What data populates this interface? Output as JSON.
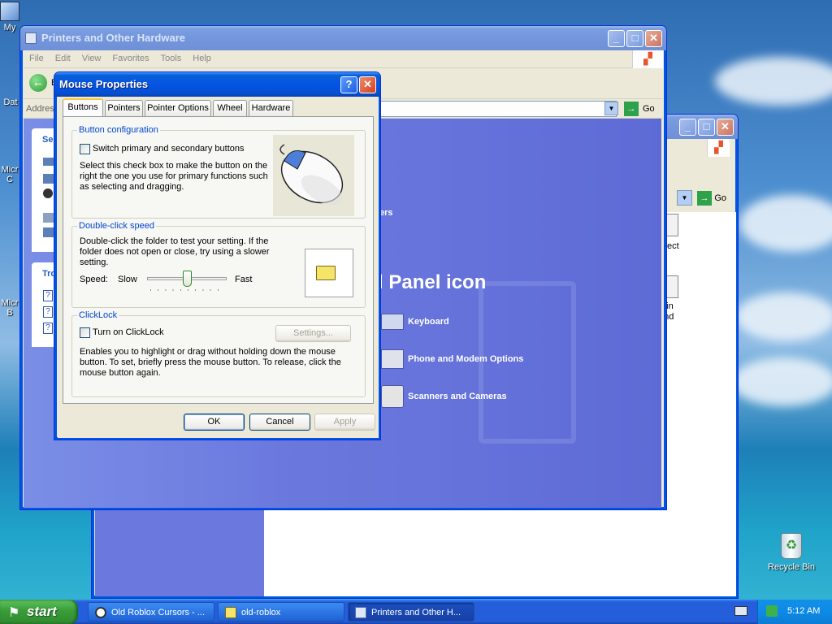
{
  "desktop": {
    "icons": [
      {
        "label": "My"
      },
      {
        "label": "Dat"
      },
      {
        "label": "Micr C"
      },
      {
        "label": "Micr B"
      },
      {
        "label": "Recycle Bin"
      }
    ]
  },
  "back_window": {
    "address_go": "Go",
    "items": [
      {
        "label": "ect"
      },
      {
        "label": "g in"
      },
      {
        "label": "und"
      }
    ]
  },
  "main_window": {
    "title": "Printers and Other Hardware",
    "menu": [
      "File",
      "Edit",
      "View",
      "Favorites",
      "Tools",
      "Help"
    ],
    "back_label": "B",
    "address_label": "Address",
    "go_label": "Go",
    "left_panel": {
      "section1_title": "Se",
      "section2_title": "Tro"
    },
    "heading_fragment": "ers",
    "panel_icon_heading": "l Panel icon",
    "items": [
      {
        "label": "Keyboard"
      },
      {
        "label": "Phone and Modem Options"
      },
      {
        "label": "Scanners and Cameras"
      }
    ]
  },
  "dialog": {
    "title": "Mouse Properties",
    "tabs": [
      "Buttons",
      "Pointers",
      "Pointer Options",
      "Wheel",
      "Hardware"
    ],
    "button_config": {
      "caption": "Button configuration",
      "checkbox_label": "Switch primary and secondary buttons",
      "description": "Select this check box to make the button on the right the one you use for primary functions such as selecting and dragging."
    },
    "double_click": {
      "caption": "Double-click speed",
      "description": "Double-click the folder to test your setting. If the folder does not open or close, try using a slower setting.",
      "speed_label": "Speed:",
      "slow_label": "Slow",
      "fast_label": "Fast",
      "speed_level": 0.5
    },
    "clicklock": {
      "caption": "ClickLock",
      "checkbox_label": "Turn on ClickLock",
      "settings_button": "Settings...",
      "description": "Enables you to highlight or drag without holding down the mouse button. To set, briefly press the mouse button. To release, click the mouse button again."
    },
    "buttons": {
      "ok": "OK",
      "cancel": "Cancel",
      "apply": "Apply"
    }
  },
  "taskbar": {
    "start_label": "start",
    "tasks": [
      {
        "label": "Old Roblox Cursors - ..."
      },
      {
        "label": "old-roblox"
      },
      {
        "label": "Printers and Other H..."
      }
    ],
    "clock": "5:12 AM"
  }
}
